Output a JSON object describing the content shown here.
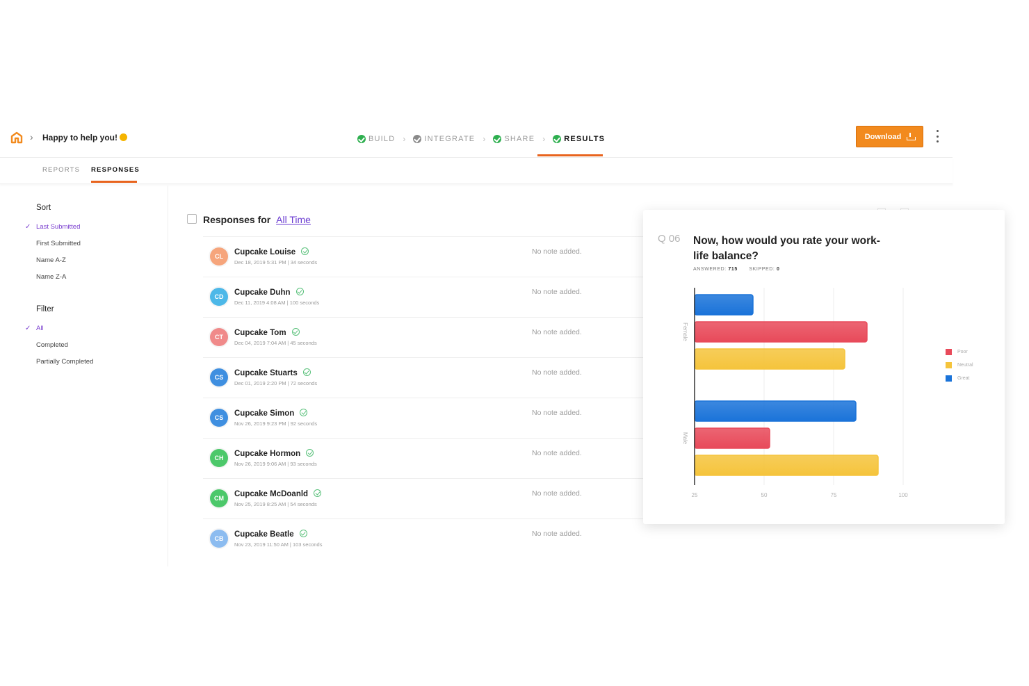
{
  "header": {
    "breadcrumb_title": "Happy to help you!",
    "steps": [
      {
        "label": "BUILD",
        "state": "done"
      },
      {
        "label": "INTEGRATE",
        "state": "pending"
      },
      {
        "label": "SHARE",
        "state": "done"
      },
      {
        "label": "RESULTS",
        "state": "active"
      }
    ],
    "download_label": "Download",
    "accent_color": "#e8641e"
  },
  "tabs": [
    {
      "label": "REPORTS",
      "active": false
    },
    {
      "label": "RESPONSES",
      "active": true
    }
  ],
  "sidebar": {
    "sort_heading": "Sort",
    "sort_options": [
      {
        "label": "Last Submitted",
        "selected": true
      },
      {
        "label": "First Submitted",
        "selected": false
      },
      {
        "label": "Name A-Z",
        "selected": false
      },
      {
        "label": "Name Z-A",
        "selected": false
      }
    ],
    "filter_heading": "Filter",
    "filter_options": [
      {
        "label": "All",
        "selected": true
      },
      {
        "label": "Completed",
        "selected": false
      },
      {
        "label": "Partially Completed",
        "selected": false
      }
    ]
  },
  "responses": {
    "heading": "Responses for",
    "range_link": "All Time",
    "rows": [
      {
        "initials": "CL",
        "name": "Cupcake Louise",
        "meta": "Dec 18, 2019 5:31 PM | 34 seconds",
        "note": "No note added.",
        "color": "#f6a57c"
      },
      {
        "initials": "CD",
        "name": "Cupcake Duhn",
        "meta": "Dec 11, 2019 4:08 AM | 100 seconds",
        "note": "No note added.",
        "color": "#4db8e8"
      },
      {
        "initials": "CT",
        "name": "Cupcake Tom",
        "meta": "Dec 04, 2019 7:04 AM | 45 seconds",
        "note": "No note added.",
        "color": "#f08a8a"
      },
      {
        "initials": "CS",
        "name": "Cupcake Stuarts",
        "meta": "Dec 01, 2019 2:20 PM | 72 seconds",
        "note": "No note added.",
        "color": "#3f8fe0"
      },
      {
        "initials": "CS",
        "name": "Cupcake Simon",
        "meta": "Nov 26, 2019 9:23 PM | 92 seconds",
        "note": "No note added.",
        "color": "#3f8fe0"
      },
      {
        "initials": "CH",
        "name": "Cupcake Hormon",
        "meta": "Nov 26, 2019 9:06 AM | 93 seconds",
        "note": "No note added.",
        "color": "#4cc86a"
      },
      {
        "initials": "CM",
        "name": "Cupcake McDoanld",
        "meta": "Nov 25, 2019 8:25 AM | 54 seconds",
        "note": "No note added.",
        "color": "#4cc86a"
      },
      {
        "initials": "CB",
        "name": "Cupcake Beatle",
        "meta": "Nov 23, 2019 11:50 AM | 103 seconds",
        "note": "No note added.",
        "color": "#8cbcf0"
      }
    ]
  },
  "question_card": {
    "number": "Q 06",
    "title": "Now, how would you rate your work-life balance?",
    "answered_label": "ANSWERED:",
    "answered_value": "715",
    "skipped_label": "SKIPPED:",
    "skipped_value": "0"
  },
  "chart_data": {
    "type": "bar",
    "orientation": "horizontal",
    "categories": [
      "Female",
      "Male"
    ],
    "series": [
      {
        "name": "Great",
        "values": [
          46,
          83
        ],
        "color": "#1a73d9"
      },
      {
        "name": "Poor",
        "values": [
          87,
          52
        ],
        "color": "#e84a5a"
      },
      {
        "name": "Neutral",
        "values": [
          79,
          91
        ],
        "color": "#f5c43c"
      }
    ],
    "x_ticks": [
      "25",
      "50",
      "75",
      "100"
    ],
    "xlim": [
      25,
      100
    ],
    "legend": [
      {
        "name": "Poor",
        "color": "#e84a5a"
      },
      {
        "name": "Neutral",
        "color": "#f5c43c"
      },
      {
        "name": "Great",
        "color": "#1a73d9"
      }
    ],
    "legend_position": "right",
    "grid": true
  }
}
